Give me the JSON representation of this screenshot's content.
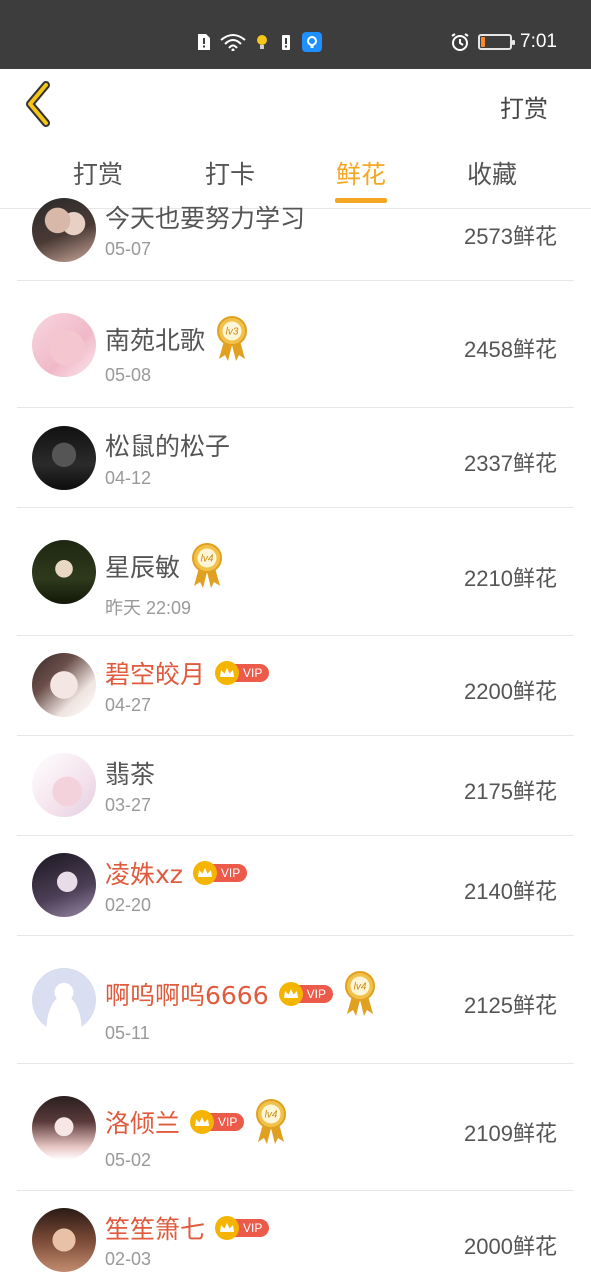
{
  "status_bar": {
    "time": "7:01",
    "battery_level": 0.15
  },
  "header": {
    "action_label": "打赏"
  },
  "tabs": [
    {
      "label": "打赏"
    },
    {
      "label": "打卡"
    },
    {
      "label": "鲜花"
    },
    {
      "label": "收藏"
    }
  ],
  "active_tab_index": 2,
  "vip_text": "VIP",
  "rows": [
    {
      "name": "今天也要努力学习",
      "date": "05-07",
      "amount": "2573鲜花",
      "vip": false,
      "level": "",
      "avatar": "avatar-couple"
    },
    {
      "name": "南苑北歌",
      "date": "05-08",
      "amount": "2458鲜花",
      "vip": false,
      "level": "lv3",
      "avatar": "avatar-pink"
    },
    {
      "name": "松鼠的松子",
      "date": "04-12",
      "amount": "2337鲜花",
      "vip": false,
      "level": "",
      "avatar": "avatar-dark"
    },
    {
      "name": "星辰敏",
      "date": "昨天 22:09",
      "amount": "2210鲜花",
      "vip": false,
      "level": "lv4",
      "avatar": "avatar-forest"
    },
    {
      "name": "碧空皎月",
      "date": "04-27",
      "amount": "2200鲜花",
      "vip": true,
      "level": "",
      "avatar": "avatar-girl-sketch"
    },
    {
      "name": "翡茶",
      "date": "03-27",
      "amount": "2175鲜花",
      "vip": false,
      "level": "",
      "avatar": "avatar-anime"
    },
    {
      "name": "凌姝xz",
      "date": "02-20",
      "amount": "2140鲜花",
      "vip": true,
      "level": "",
      "avatar": "avatar-purple"
    },
    {
      "name": "啊呜啊呜6666",
      "date": "05-11",
      "amount": "2125鲜花",
      "vip": true,
      "level": "lv4",
      "avatar": "avatar-default"
    },
    {
      "name": "洛倾兰",
      "date": "05-02",
      "amount": "2109鲜花",
      "vip": true,
      "level": "lv4",
      "avatar": "avatar-ancient"
    },
    {
      "name": "笙笙箫七",
      "date": "02-03",
      "amount": "2000鲜花",
      "vip": true,
      "level": "",
      "avatar": "avatar-portrait"
    }
  ]
}
